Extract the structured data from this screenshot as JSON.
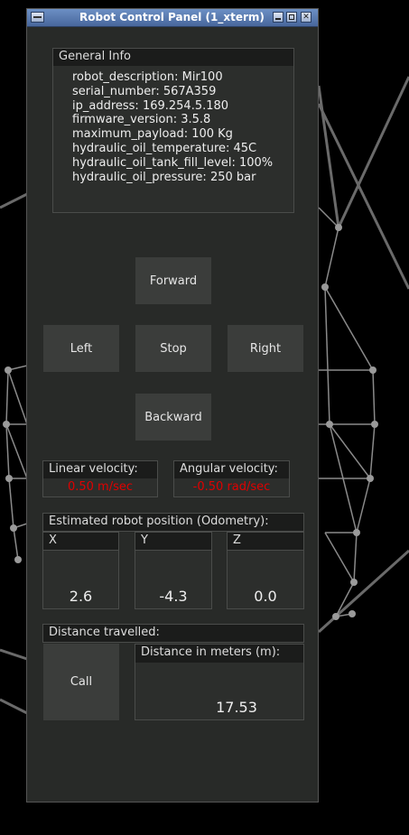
{
  "window": {
    "title": "Robot Control Panel (1_xterm)"
  },
  "general_info": {
    "header": "General Info",
    "lines": [
      "robot_description: Mir100",
      "serial_number: 567A359",
      "ip_address: 169.254.5.180",
      "firmware_version: 3.5.8",
      "maximum_payload: 100 Kg",
      "hydraulic_oil_temperature: 45C",
      "hydraulic_oil_tank_fill_level: 100%",
      "hydraulic_oil_pressure: 250 bar"
    ]
  },
  "controls": {
    "forward": "Forward",
    "left": "Left",
    "stop": "Stop",
    "right": "Right",
    "backward": "Backward"
  },
  "velocity": {
    "linear_label": "Linear velocity:",
    "linear_value": "0.50 m/sec",
    "angular_label": "Angular velocity:",
    "angular_value": "-0.50 rad/sec",
    "value_color": "#e00000"
  },
  "odometry": {
    "header": "Estimated robot position (Odometry):",
    "x_label": "X",
    "x_value": "2.6",
    "y_label": "Y",
    "y_value": "-4.3",
    "z_label": "Z",
    "z_value": "0.0"
  },
  "distance": {
    "header": "Distance travelled:",
    "call_button": "Call",
    "meters_label": "Distance in meters (m):",
    "meters_value": "17.53"
  },
  "colors": {
    "panel_bg": "#282a28",
    "title_bar": "#5a7bb0",
    "button_bg": "#3b3d3b"
  }
}
